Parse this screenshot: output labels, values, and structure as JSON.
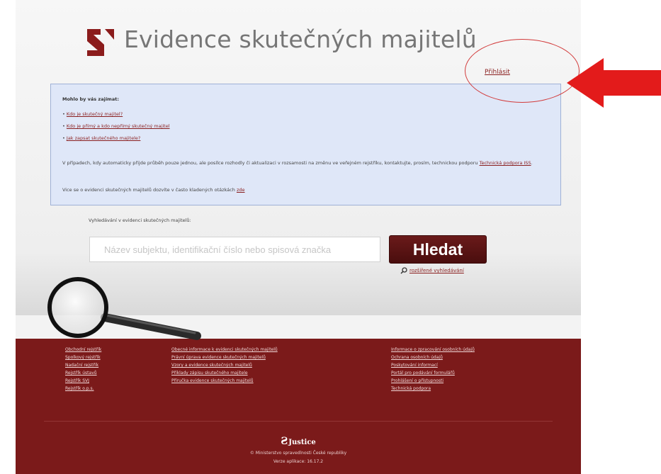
{
  "header": {
    "title": "Evidence skutečných majitelů",
    "login_label": "Přihlásit"
  },
  "info": {
    "heading": "Mohlo by vás zajímat:",
    "questions": [
      "Kdo je skutečný majitel?",
      "Kdo je přímý a kdo nepřímý skutečný majitel",
      "Jak zapsat skutečného majitele?"
    ],
    "paragraph_text": "V případech, kdy automaticky přijde průběh pouze jednou, ale posílce rozhodly či aktualizaci v rozsamosti na změnu ve veřejném rejstříku, kontaktujte, prosím, technickou podporu",
    "paragraph_link": "Technická podpora ISS",
    "more_text": "Vice se o evidenci skutečných majitelů dozvíte v často kladených otázkách",
    "more_link": "zde"
  },
  "search": {
    "label": "Vyhledávání v evidenci skutečných majitelů:",
    "placeholder": "Název subjektu, identifikační číslo nebo spisová značka",
    "button_label": "Hledat",
    "advanced_label": "rozšířené vyhledávání"
  },
  "footer": {
    "col1": [
      "Obchodní rejstřík",
      "Spolkový rejstřík",
      "Nadační rejstřík",
      "Rejstřík ústavů",
      "Rejstřík SVJ",
      "Rejstřík o.p.s."
    ],
    "col2": [
      "Obecné informace k evidenci skutečných majitelů",
      "Právní úprava evidence skutečných majitelů",
      "Vzory a evidence skutečných majitelů",
      "Příklady zápisu skutečného majitele",
      "Příručka evidence skutečných majitelů"
    ],
    "col3": [
      "Informace o zpracování osobních údajů",
      "Ochrana osobních údajů",
      "Poskytování informací",
      "Portál pro podávání formulářů",
      "Prohlášení o přístupnosti",
      "Technická podpora"
    ],
    "brand": "Justice",
    "copyright": "© Ministerstvo spravedlnosti České republiky",
    "version": "Verze aplikace: 16.17.2"
  },
  "colors": {
    "brand_red": "#7b1a1a",
    "button_dark_red": "#5a1212",
    "annotation_red": "#e31b1b",
    "info_box_bg": "#dfe7f8"
  },
  "icons": {
    "logo": "justice-logo-icon",
    "magnifier": "magnifying-glass-icon",
    "arrow": "red-arrow-icon"
  }
}
